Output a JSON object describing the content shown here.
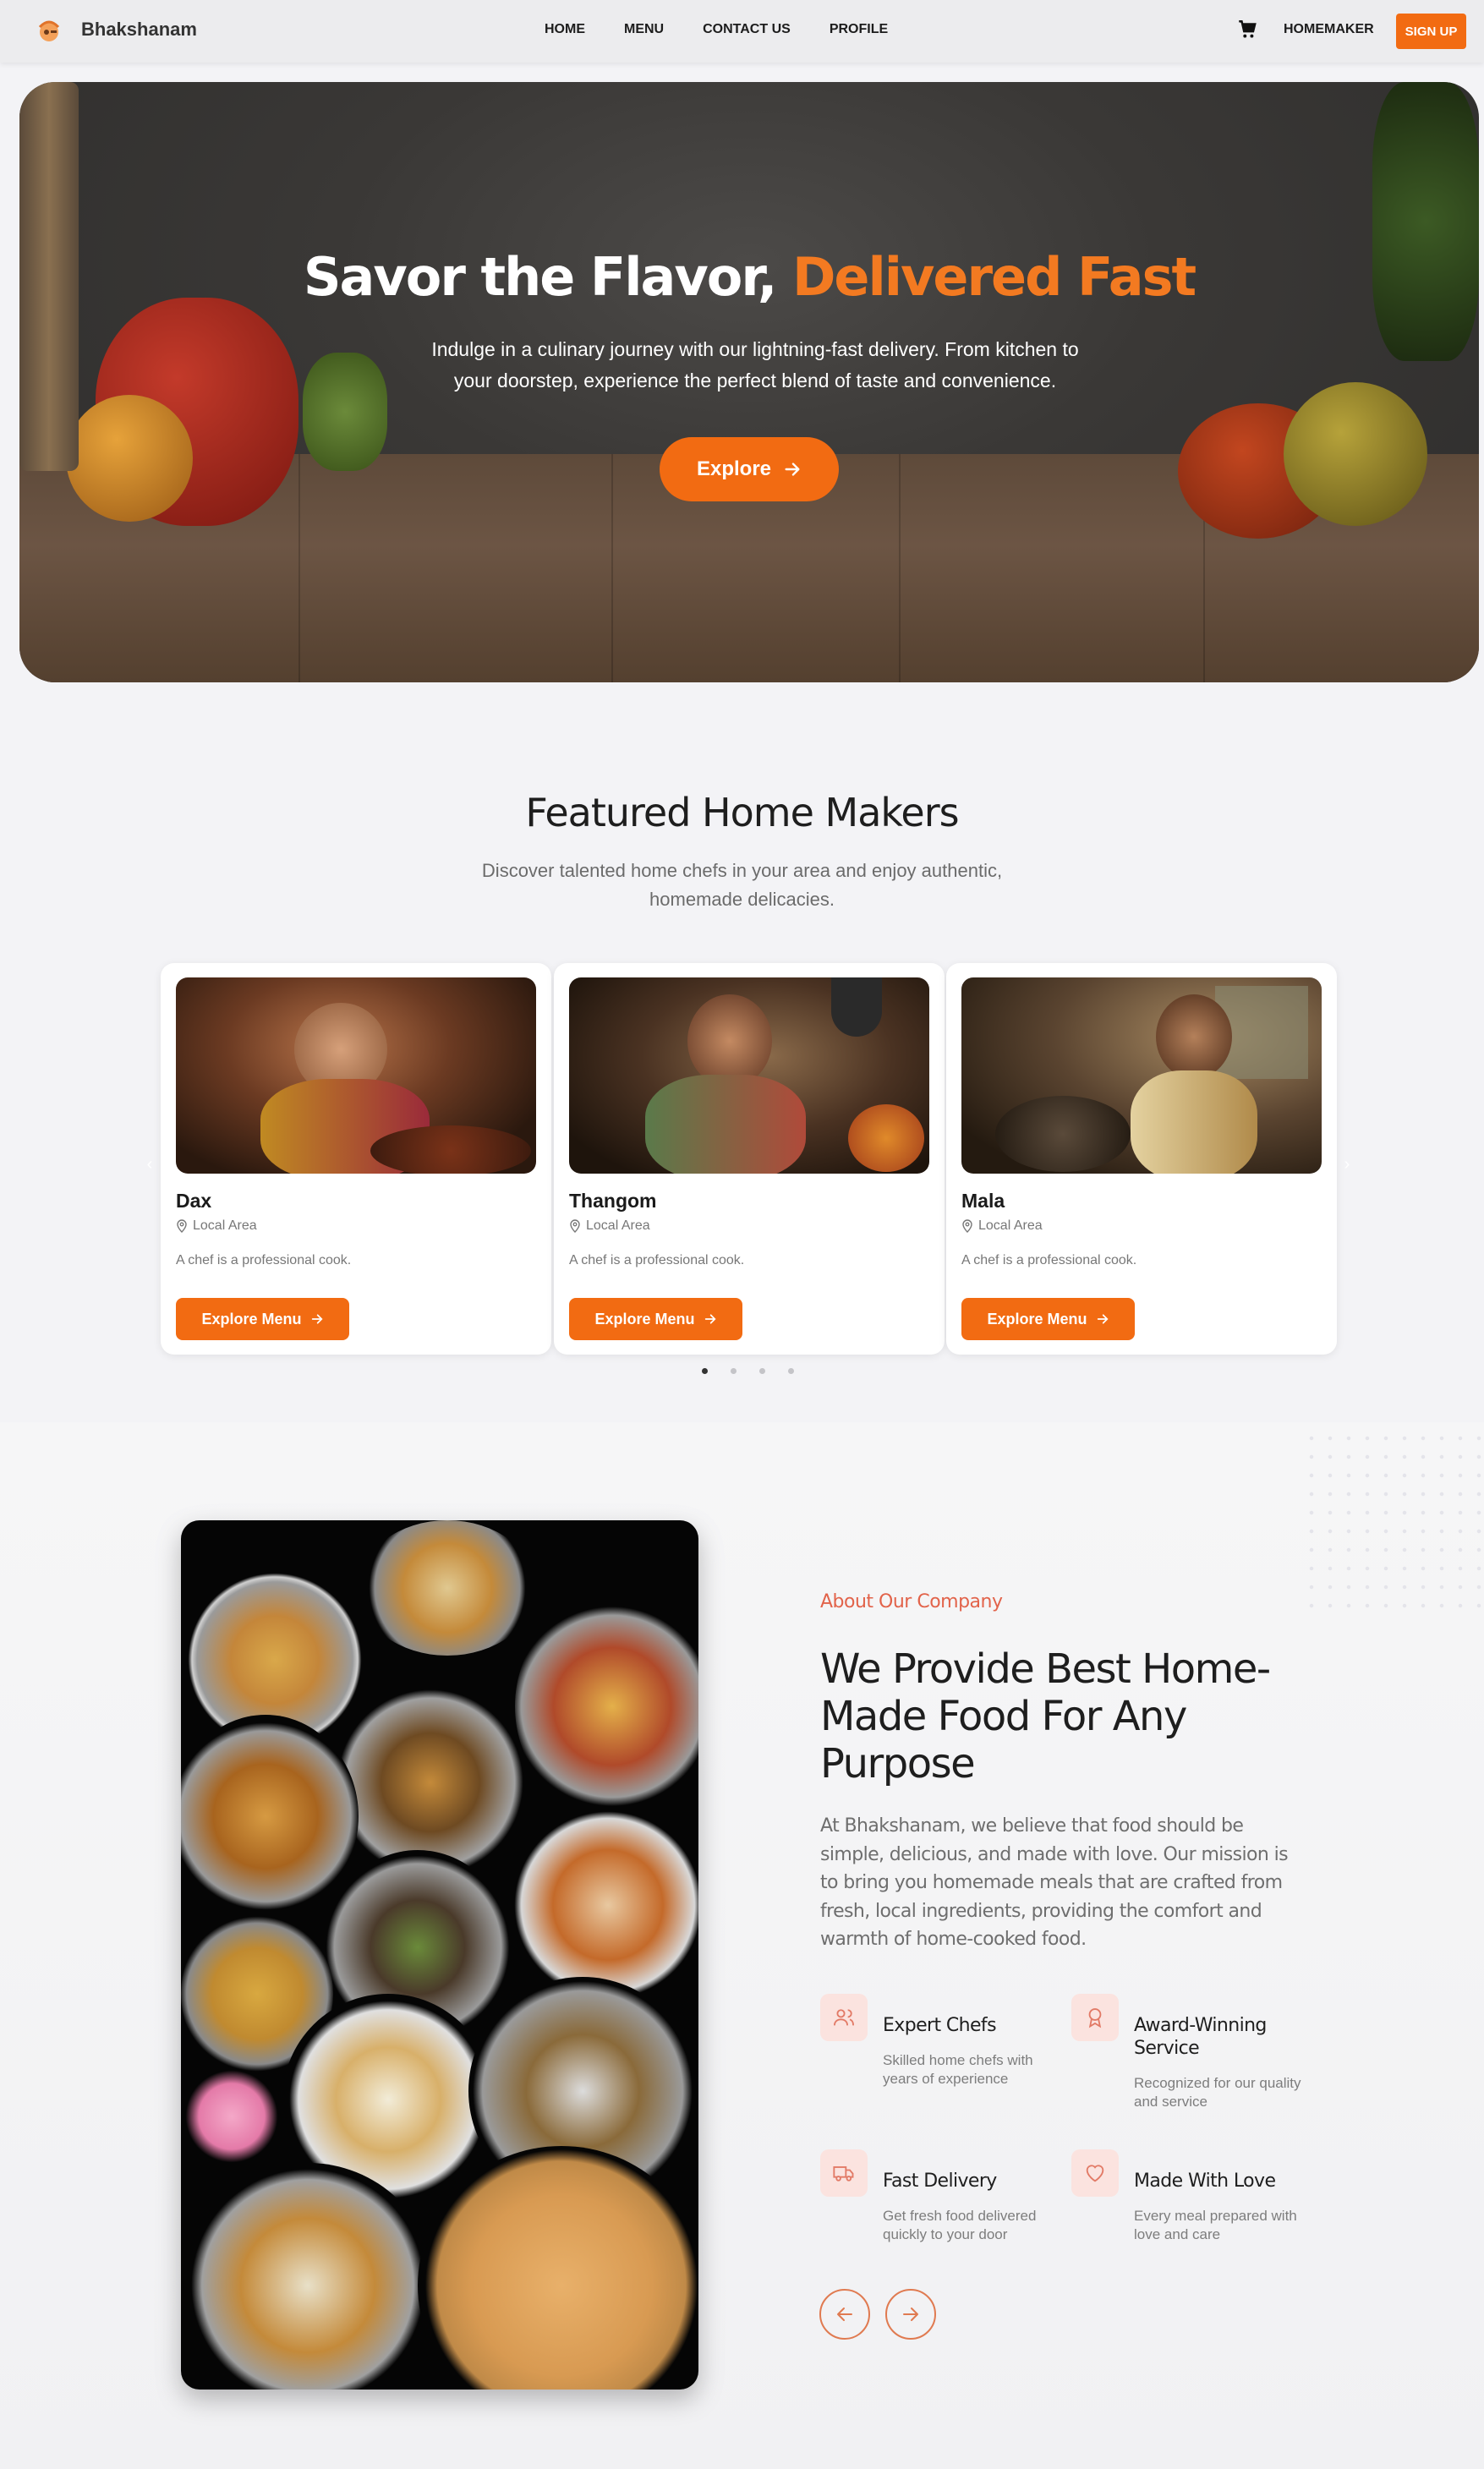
{
  "nav": {
    "brand": "Bhakshanam",
    "links": [
      "HOME",
      "MENU",
      "CONTACT US",
      "PROFILE"
    ],
    "homemaker": "HOMEMAKER",
    "signup": "SIGN UP",
    "cart_icon": "cart-icon",
    "logo_icon": "chef-logo-icon"
  },
  "hero": {
    "title_main": "Savor the Flavor, ",
    "title_accent": "Delivered Fast",
    "subtitle": "Indulge in a culinary journey with our lightning-fast delivery. From kitchen to your doorstep, experience the perfect blend of taste and convenience.",
    "cta": "Explore"
  },
  "featured": {
    "title": "Featured Home Makers",
    "subtitle": "Discover talented home chefs in your area and enjoy authentic, homemade delicacies.",
    "cards": [
      {
        "name": "Dax",
        "area": "Local Area",
        "desc": "A chef is a professional cook.",
        "button": "Explore Menu"
      },
      {
        "name": "Thangom",
        "area": "Local Area",
        "desc": "A chef is a professional cook.",
        "button": "Explore Menu"
      },
      {
        "name": "Mala",
        "area": "Local Area",
        "desc": "A chef is a professional cook.",
        "button": "Explore Menu"
      }
    ],
    "carousel_dots": 4,
    "active_dot": 0
  },
  "about": {
    "kicker": "About Our Company",
    "title": "We Provide Best Home-Made Food For Any Purpose",
    "text": "At Bhakshanam, we believe that food should be simple, delicious, and made with love. Our mission is to bring you homemade meals that are crafted from fresh, local ingredients, providing the comfort and warmth of home-cooked food.",
    "features": [
      {
        "title": "Expert Chefs",
        "desc": "Skilled home chefs with years of experience",
        "icon": "users-icon"
      },
      {
        "title": "Award-Winning Service",
        "desc": "Recognized for our quality and service",
        "icon": "award-icon"
      },
      {
        "title": "Fast Delivery",
        "desc": "Get fresh food delivered quickly to your door",
        "icon": "truck-icon"
      },
      {
        "title": "Made With Love",
        "desc": "Every meal prepared with love and care",
        "icon": "heart-icon"
      }
    ]
  },
  "colors": {
    "accent": "#f26b12",
    "accent_soft": "#e2634a"
  }
}
